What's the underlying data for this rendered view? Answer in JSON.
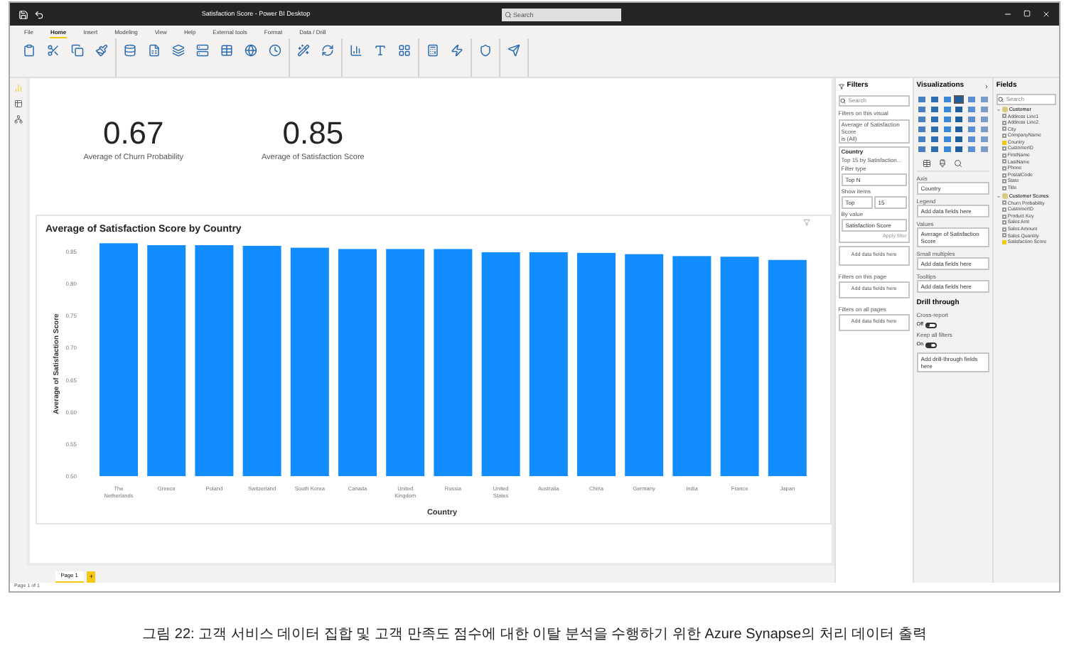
{
  "window": {
    "title": "Satisfaction Score - Power BI Desktop",
    "search": {
      "placeholder": "Search"
    }
  },
  "ribbon_tabs": [
    {
      "label": "File",
      "selected": false
    },
    {
      "label": "Home",
      "selected": true
    },
    {
      "label": "Insert",
      "selected": false
    },
    {
      "label": "Modeling",
      "selected": false
    },
    {
      "label": "View",
      "selected": false
    },
    {
      "label": "Help",
      "selected": false
    },
    {
      "label": "External tools",
      "selected": false
    },
    {
      "label": "Format",
      "selected": false
    },
    {
      "label": "Data / Drill",
      "selected": false
    }
  ],
  "cards": [
    {
      "value": "0.67",
      "label": "Average of Churn Probability"
    },
    {
      "value": "0.85",
      "label": "Average of Satisfaction Score"
    }
  ],
  "chart_data": {
    "type": "bar",
    "title": "Average of Satisfaction Score by Country",
    "xlabel": "Country",
    "ylabel": "Average of Satisfaction Score",
    "categories": [
      "The Netherlands",
      "Greece",
      "Poland",
      "Switzerland",
      "South Korea",
      "Canada",
      "United Kingdom",
      "Russia",
      "United States",
      "Australia",
      "China",
      "Germany",
      "India",
      "France",
      "Japan"
    ],
    "series": [
      {
        "color": "#118dff",
        "values": [
          0.863,
          0.86,
          0.86,
          0.859,
          0.856,
          0.854,
          0.854,
          0.854,
          0.849,
          0.849,
          0.848,
          0.846,
          0.843,
          0.842,
          0.837
        ]
      }
    ],
    "ylim": [
      0.5,
      0.87
    ],
    "yticks": [
      {
        "value": 0.5,
        "label": "0.50"
      },
      {
        "value": 0.55,
        "label": "0.55"
      },
      {
        "value": 0.6,
        "label": "0.60"
      },
      {
        "value": 0.65,
        "label": "0.65"
      },
      {
        "value": 0.7,
        "label": "0.70"
      },
      {
        "value": 0.75,
        "label": "0.75"
      },
      {
        "value": 0.8,
        "label": "0.80"
      },
      {
        "value": 0.85,
        "label": "0.85"
      }
    ]
  },
  "filters": {
    "title": "Filters",
    "search": {
      "placeholder": "Search"
    },
    "visual_heading": "Filters on this visual",
    "visual_filters": [
      {
        "title": "Average of Satisfaction Score",
        "subtitle": "is (All)"
      }
    ],
    "country": {
      "title": "Country",
      "subtitle": "Top 15 by Satisfaction...",
      "filter_type_label": "Filter type",
      "filter_type": "Top N",
      "show_items_label": "Show items",
      "show_items": "Top",
      "count": "15",
      "by_value_label": "By value",
      "by_value": "Satisfaction Score",
      "apply": "Apply filter"
    },
    "drop_hint": "Add data fields here",
    "sections": [
      {
        "heading": "Filters on this page",
        "hint": "Add data fields here"
      },
      {
        "heading": "Filters on all pages",
        "hint": "Add data fields here"
      }
    ]
  },
  "visualizations": {
    "title": "Visualizations",
    "gallery": [
      {
        "selected": false
      },
      {
        "selected": false
      },
      {
        "selected": false
      },
      {
        "selected": true
      },
      {
        "selected": false
      },
      {
        "selected": false
      },
      {
        "selected": false
      },
      {
        "selected": false
      },
      {
        "selected": false
      },
      {
        "selected": false
      },
      {
        "selected": false
      },
      {
        "selected": false
      },
      {
        "selected": false
      },
      {
        "selected": false
      },
      {
        "selected": false
      },
      {
        "selected": false
      },
      {
        "selected": false
      },
      {
        "selected": false
      },
      {
        "selected": false
      },
      {
        "selected": false
      },
      {
        "selected": false
      },
      {
        "selected": false
      },
      {
        "selected": false
      },
      {
        "selected": false
      },
      {
        "selected": false
      },
      {
        "selected": false
      },
      {
        "selected": false
      },
      {
        "selected": false
      },
      {
        "selected": false
      },
      {
        "selected": false
      },
      {
        "selected": false
      },
      {
        "selected": false
      },
      {
        "selected": false
      },
      {
        "selected": false
      },
      {
        "selected": false
      },
      {
        "selected": false
      }
    ],
    "wells": [
      {
        "label": "Axis",
        "value": "Country"
      },
      {
        "label": "Legend",
        "value": "Add data fields here"
      },
      {
        "label": "Values",
        "value": "Average of Satisfaction Score"
      },
      {
        "label": "Small multiples",
        "value": "Add data fields here"
      },
      {
        "label": "Tooltips",
        "value": "Add data fields here"
      }
    ],
    "drill": {
      "title": "Drill through",
      "cross_report_label": "Cross-report",
      "cross_report": {
        "text": "Off",
        "on": false
      },
      "keep_filters_label": "Keep all filters",
      "keep_filters": {
        "text": "On",
        "on": true
      },
      "hint": "Add drill-through fields here"
    }
  },
  "fields": {
    "title": "Fields",
    "search": {
      "placeholder": "Search"
    },
    "tables": [
      {
        "name": "Customer",
        "expanded": true,
        "children": [
          {
            "name": "Address Line1",
            "checked": false
          },
          {
            "name": "Address Line2",
            "checked": false
          },
          {
            "name": "City",
            "checked": false
          },
          {
            "name": "CompanyName",
            "checked": false
          },
          {
            "name": "Country",
            "checked": true
          },
          {
            "name": "CustomerID",
            "checked": false
          },
          {
            "name": "FirstName",
            "checked": false
          },
          {
            "name": "LastName",
            "checked": false
          },
          {
            "name": "Phone",
            "checked": false
          },
          {
            "name": "PostalCode",
            "checked": false
          },
          {
            "name": "State",
            "checked": false
          },
          {
            "name": "Title",
            "checked": false
          }
        ]
      },
      {
        "name": "Customer Scores",
        "expanded": true,
        "children": [
          {
            "name": "Churn Probability",
            "checked": false
          },
          {
            "name": "CustomerID",
            "checked": false
          },
          {
            "name": "Product Key",
            "checked": false
          },
          {
            "name": "Sales Amt",
            "checked": false
          },
          {
            "name": "Sales Amount",
            "checked": false
          },
          {
            "name": "Sales Quantity",
            "checked": false
          },
          {
            "name": "Satisfaction Score",
            "checked": true
          }
        ]
      }
    ]
  },
  "pages": [
    {
      "label": "Page 1",
      "selected": true
    }
  ],
  "add_page": "+",
  "status_bar": "Page 1 of 1",
  "caption": "그림 22: 고객 서비스 데이터 집합 및 고객 만족도 점수에 대한 이탈 분석을 수행하기 위한 Azure Synapse의 처리 데이터 출력"
}
